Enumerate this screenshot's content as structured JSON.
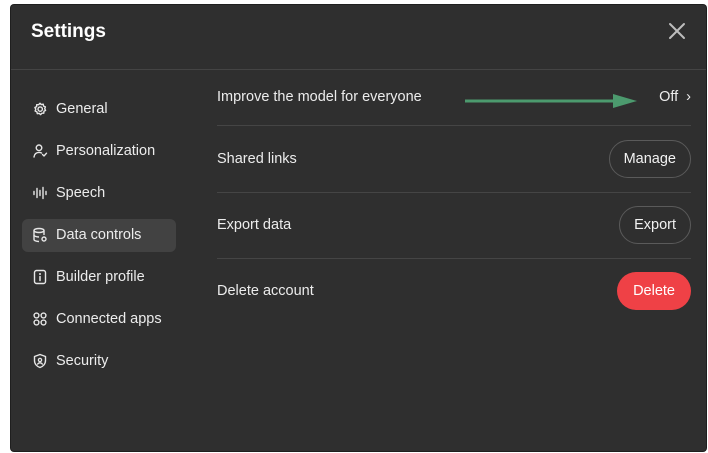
{
  "dialog": {
    "title": "Settings",
    "close_icon": "close-icon"
  },
  "sidebar": {
    "items": [
      {
        "label": "General",
        "icon": "gear-icon",
        "active": false
      },
      {
        "label": "Personalization",
        "icon": "person-icon",
        "active": false
      },
      {
        "label": "Speech",
        "icon": "waveform-icon",
        "active": false
      },
      {
        "label": "Data controls",
        "icon": "database-icon",
        "active": true
      },
      {
        "label": "Builder profile",
        "icon": "id-card-icon",
        "active": false
      },
      {
        "label": "Connected apps",
        "icon": "apps-grid-icon",
        "active": false
      },
      {
        "label": "Security",
        "icon": "shield-icon",
        "active": false
      }
    ]
  },
  "data_controls": {
    "improve_model": {
      "label": "Improve the model for everyone",
      "value": "Off",
      "chevron": "›"
    },
    "shared_links": {
      "label": "Shared links",
      "button": "Manage"
    },
    "export_data": {
      "label": "Export data",
      "button": "Export"
    },
    "delete_account": {
      "label": "Delete account",
      "button": "Delete"
    }
  },
  "annotation": {
    "arrow_color": "#4c9a6e"
  },
  "colors": {
    "panel_background": "#2f2f2f",
    "active_item_background": "#424242",
    "danger": "#ef4146",
    "text": "#ececec"
  }
}
